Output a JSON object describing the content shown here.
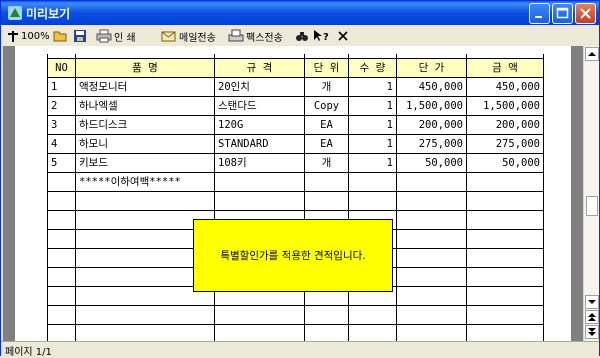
{
  "window": {
    "title": "미리보기"
  },
  "toolbar": {
    "zoom_label": "100%",
    "print_label": "인   쇄",
    "email_label": "메일전송",
    "fax_label": "팩스전송"
  },
  "table": {
    "headers": [
      "NO",
      "품          명",
      "규          격",
      "단 위",
      "수 량",
      "단   가",
      "금   액"
    ],
    "rows": [
      [
        "1",
        "액정모니터",
        "20인치",
        "개",
        "1",
        "450,000",
        "450,000"
      ],
      [
        "2",
        "하나엑셀",
        "스탠다드",
        "Copy",
        "1",
        "1,500,000",
        "1,500,000"
      ],
      [
        "3",
        "하드디스크",
        "120G",
        "EA",
        "1",
        "200,000",
        "200,000"
      ],
      [
        "4",
        "하모니",
        "STANDARD",
        "EA",
        "1",
        "275,000",
        "275,000"
      ],
      [
        "5",
        "키보드",
        "108키",
        "개",
        "1",
        "50,000",
        "50,000"
      ]
    ],
    "footer_note": "*****이하여백*****"
  },
  "note": "특별할인가를 적용한 견적입니다.",
  "status": {
    "page": "페이지 1/1"
  }
}
